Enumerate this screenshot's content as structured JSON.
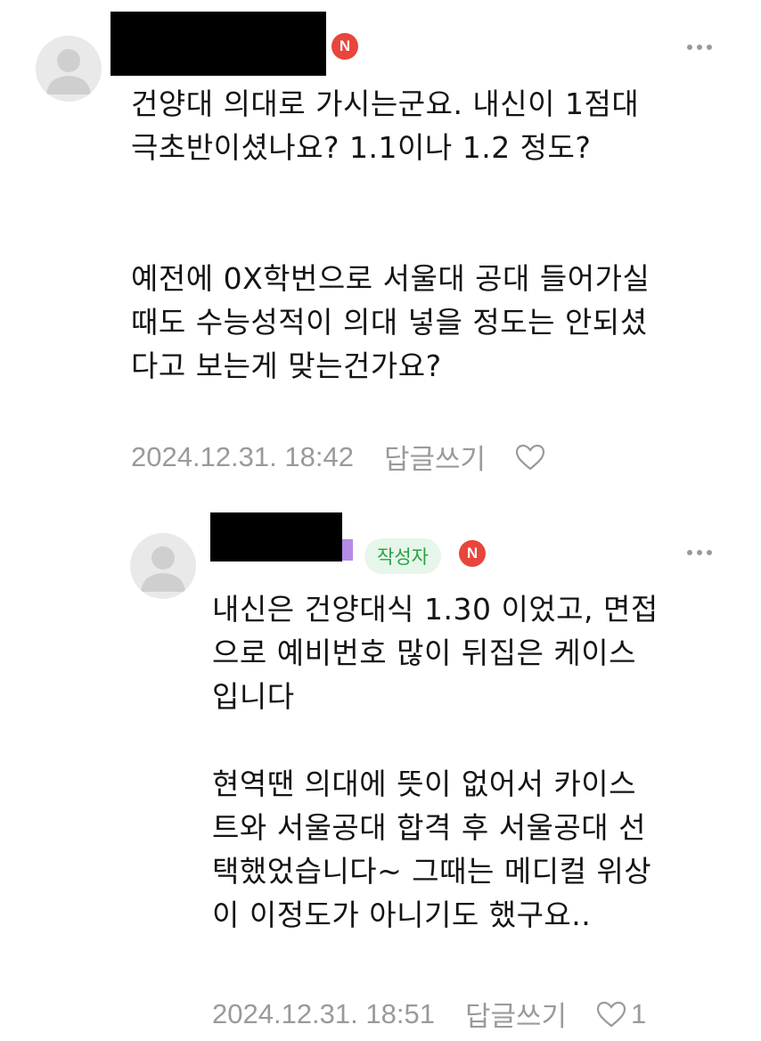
{
  "comments": [
    {
      "badge": "N",
      "text": "건양대 의대로 가시는군요. 내신이 1점대\n극초반이셨나요? 1.1이나 1.2 정도?\n\n\n예전에 0X학번으로 서울대 공대 들어가실\n때도 수능성적이 의대 넣을 정도는 안되셨\n다고 보는게 맞는건가요?",
      "timestamp": "2024.12.31. 18:42",
      "reply_label": "답글쓰기",
      "likes": ""
    },
    {
      "author_tag": "작성자",
      "badge": "N",
      "text": "내신은 건양대식 1.30 이었고, 면접\n으로 예비번호 많이 뒤집은 케이스\n입니다\n\n현역땐 의대에 뜻이 없어서 카이스\n트와 서울공대 합격 후 서울공대 선\n택했었습니다~ 그때는 메디컬 위상\n이 이정도가 아니기도 했구요..",
      "timestamp": "2024.12.31. 18:51",
      "reply_label": "답글쓰기",
      "likes": "1"
    }
  ],
  "colors": {
    "badge_red": "#e8453c",
    "author_tag_bg": "#e7f6ea",
    "author_tag_text": "#27a244",
    "meta_gray": "#9a9a9a"
  },
  "icons": [
    "avatar-placeholder-icon",
    "more-options-icon",
    "heart-icon"
  ]
}
